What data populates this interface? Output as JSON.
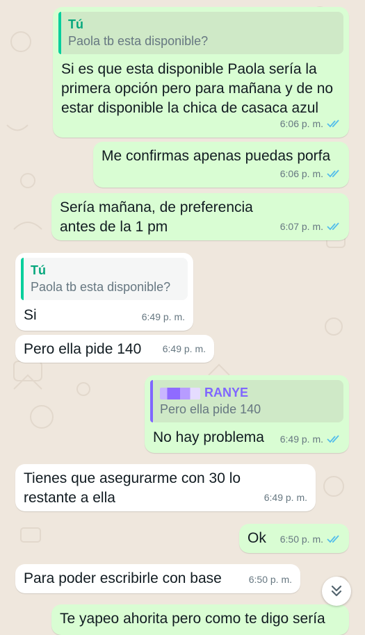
{
  "messages": [
    {
      "direction": "out",
      "quote": {
        "author": "Tú",
        "text": "Paola tb esta disponible?"
      },
      "text": "Si es que esta disponible Paola sería la primera opción pero para mañana y de no estar disponible la chica de casaca azul",
      "time": "6:06 p. m.",
      "status": "read"
    },
    {
      "direction": "out",
      "text": "Me confirmas apenas puedas porfa",
      "time": "6:06 p. m.",
      "status": "read"
    },
    {
      "direction": "out",
      "text": "Sería mañana, de preferencia antes de la 1 pm",
      "time": "6:07 p. m.",
      "status": "read"
    },
    {
      "direction": "in",
      "quote": {
        "author": "Tú",
        "text": "Paola tb esta disponible?"
      },
      "text": "Si",
      "time": "6:49 p. m."
    },
    {
      "direction": "in",
      "text": "Pero ella pide 140",
      "time": "6:49 p. m."
    },
    {
      "direction": "out",
      "quote": {
        "author": "RANYE",
        "text": "Pero ella pide 140"
      },
      "text": "No hay problema",
      "time": "6:49 p. m.",
      "status": "read"
    },
    {
      "direction": "in",
      "text": "Tienes que asegurarme con 30 lo restante a ella",
      "time": "6:49 p. m."
    },
    {
      "direction": "out",
      "text": "Ok",
      "time": "6:50 p. m.",
      "status": "read"
    },
    {
      "direction": "in",
      "text": "Para poder escribirle con base",
      "time": "6:50 p. m."
    },
    {
      "direction": "out",
      "text": "Te yapeo ahorita pero como te digo sería"
    }
  ],
  "icons": {
    "read_receipt": "double-check-icon",
    "scroll": "chevron-double-down-icon"
  },
  "colors": {
    "outgoing": "#d9fdd3",
    "incoming": "#ffffff",
    "ticks": "#53bdeb",
    "background": "#efe7dd"
  }
}
